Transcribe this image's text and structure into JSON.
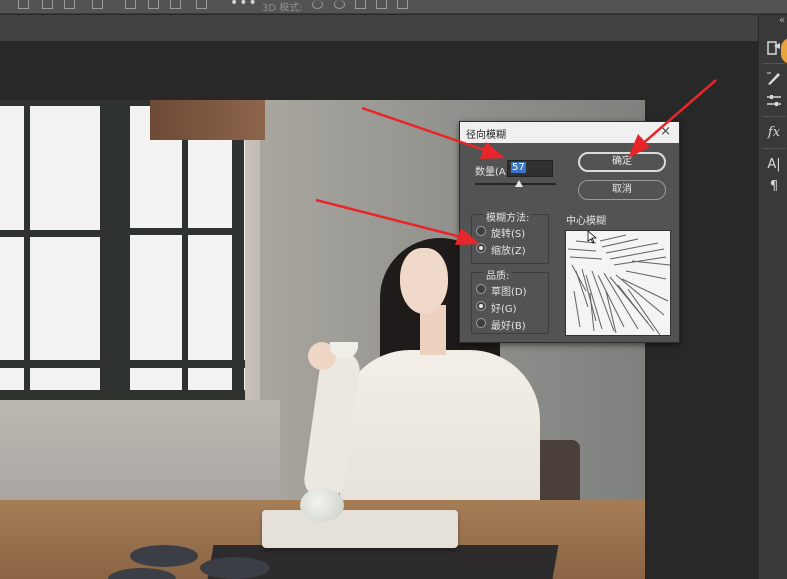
{
  "options_bar": {
    "threed_mode_label": "3D 模式:"
  },
  "dialog": {
    "title": "径向模糊",
    "close_glyph": "×",
    "amount": {
      "label": "数量(A",
      "value": "57",
      "value_percent_of_slider": 57
    },
    "ok_label": "确定",
    "cancel_label": "取消",
    "blur_method": {
      "legend": "模糊方法:",
      "options": [
        {
          "label": "旋转(S)",
          "selected": false
        },
        {
          "label": "缩放(Z)",
          "selected": true
        }
      ]
    },
    "quality": {
      "legend": "品质:",
      "options": [
        {
          "label": "草图(D)",
          "selected": false
        },
        {
          "label": "好(G)",
          "selected": true
        },
        {
          "label": "最好(B)",
          "selected": false
        }
      ]
    },
    "center_label": "中心模糊"
  },
  "right_panel": {
    "collapse_glyph": "«",
    "icons": [
      "history-brush-icon",
      "brush-settings-icon",
      "adjustments-icon",
      "fx-icon",
      "character-icon",
      "paragraph-icon"
    ],
    "fx_label": "fx",
    "character_label": "A|",
    "paragraph_label": "¶"
  },
  "colors": {
    "annotation_arrow": "#e8262a",
    "panel_bg": "#535353",
    "selection": "#3b74c5"
  }
}
